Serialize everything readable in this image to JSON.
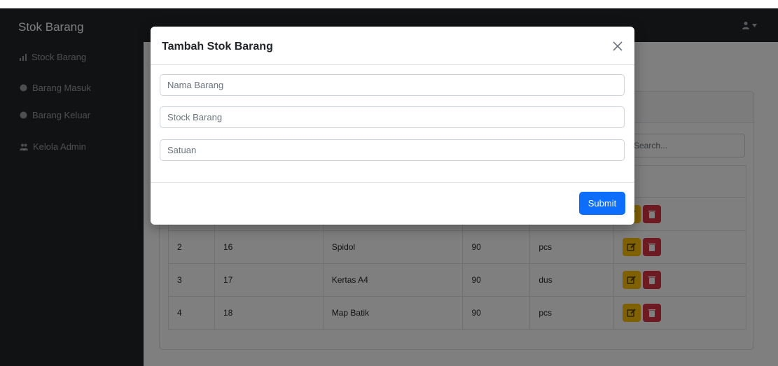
{
  "app": {
    "brand": "Stok Barang"
  },
  "sidebar": {
    "items": [
      {
        "label": "Stock Barang",
        "icon": "chart-bar-icon"
      },
      {
        "label": "Barang Masuk",
        "icon": "circle-icon"
      },
      {
        "label": "Barang Keluar",
        "icon": "circle-icon"
      },
      {
        "label": "Kelola Admin",
        "icon": "users-icon"
      }
    ]
  },
  "main": {
    "search_placeholder": "Search...",
    "rows": [
      {
        "no": "2",
        "id": "16",
        "nama": "Spidol",
        "stock": "90",
        "satuan": "pcs"
      },
      {
        "no": "3",
        "id": "17",
        "nama": "Kertas A4",
        "stock": "90",
        "satuan": "dus"
      },
      {
        "no": "4",
        "id": "18",
        "nama": "Map Batik",
        "stock": "90",
        "satuan": "pcs"
      }
    ]
  },
  "modal": {
    "title": "Tambah Stok Barang",
    "fields": [
      {
        "placeholder": "Nama Barang",
        "value": ""
      },
      {
        "placeholder": "Stock Barang",
        "value": ""
      },
      {
        "placeholder": "Satuan",
        "value": ""
      }
    ],
    "submit_label": "Submit"
  },
  "colors": {
    "primary": "#0d6efd",
    "warning": "#ffc107",
    "danger": "#dc3545",
    "dark": "#212529"
  }
}
